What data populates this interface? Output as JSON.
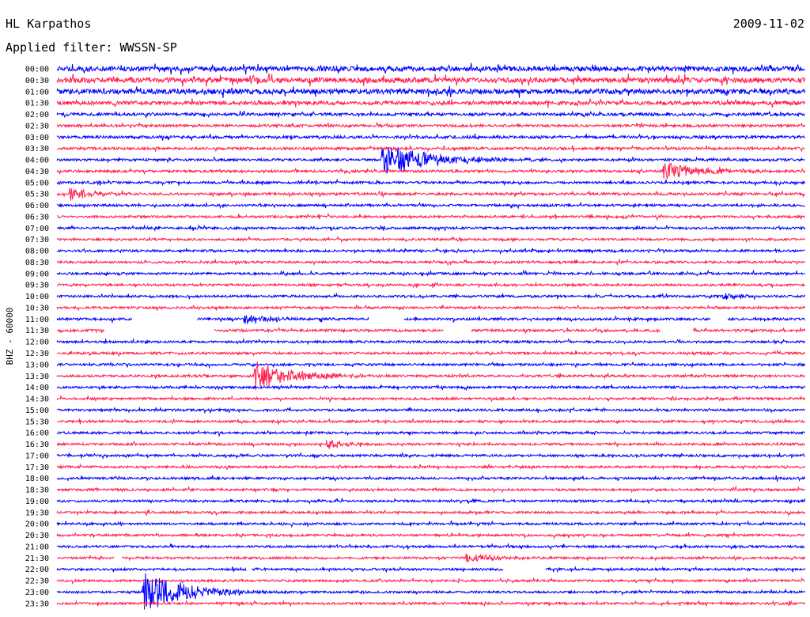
{
  "header": {
    "station": "HL Karpathos",
    "date": "2009-11-02",
    "filter": "Applied filter: WWSSN-SP"
  },
  "chart_data": {
    "type": "line",
    "title": "HL Karpathos",
    "channel_label": "BHZ - 60000",
    "time_labels": [
      "00:00",
      "00:30",
      "01:00",
      "01:30",
      "02:00",
      "02:30",
      "03:00",
      "03:30",
      "04:00",
      "04:30",
      "05:00",
      "05:30",
      "06:00",
      "06:30",
      "07:00",
      "07:30",
      "08:00",
      "08:30",
      "09:00",
      "09:30",
      "10:00",
      "10:30",
      "11:00",
      "11:30",
      "12:00",
      "12:30",
      "13:00",
      "13:30",
      "14:00",
      "14:30",
      "15:00",
      "15:30",
      "16:00",
      "16:30",
      "17:00",
      "17:30",
      "18:00",
      "18:30",
      "19:00",
      "19:30",
      "20:00",
      "20:30",
      "21:00",
      "21:30",
      "22:00",
      "22:30",
      "23:00",
      "23:30"
    ],
    "trace_colors": [
      "#0000ff",
      "#ff2050"
    ],
    "minutes_per_line": 30,
    "noise_level_by_line": [
      3.0,
      3.2,
      3.2,
      2.4,
      1.8,
      1.6,
      1.7,
      1.6,
      1.5,
      1.5,
      1.5,
      1.5,
      1.4,
      1.4,
      1.4,
      1.4,
      1.4,
      1.4,
      1.4,
      1.4,
      1.4,
      1.4,
      1.5,
      1.5,
      1.4,
      1.4,
      1.4,
      1.4,
      1.4,
      1.4,
      1.4,
      1.4,
      1.4,
      1.4,
      1.4,
      1.4,
      1.4,
      1.4,
      1.4,
      1.4,
      1.4,
      1.4,
      1.4,
      1.4,
      1.4,
      1.4,
      1.4,
      1.4
    ],
    "events": [
      {
        "line": 8,
        "minute": 13.0,
        "amplitude": 14,
        "duration_min": 2.0
      },
      {
        "line": 9,
        "minute": 24.3,
        "amplitude": 8,
        "duration_min": 1.4
      },
      {
        "line": 11,
        "minute": 0.5,
        "amplitude": 6,
        "duration_min": 0.8
      },
      {
        "line": 20,
        "minute": 26.7,
        "amplitude": 4,
        "duration_min": 0.6
      },
      {
        "line": 22,
        "minute": 7.5,
        "amplitude": 4,
        "duration_min": 1.0
      },
      {
        "line": 27,
        "minute": 7.9,
        "amplitude": 12,
        "duration_min": 1.6
      },
      {
        "line": 33,
        "minute": 10.8,
        "amplitude": 4,
        "duration_min": 0.8
      },
      {
        "line": 43,
        "minute": 16.4,
        "amplitude": 5,
        "duration_min": 0.9
      },
      {
        "line": 46,
        "minute": 3.4,
        "amplitude": 18,
        "duration_min": 1.6
      }
    ],
    "gaps": [
      {
        "line": 22,
        "start_min": 3.0,
        "end_min": 5.6
      },
      {
        "line": 22,
        "start_min": 12.5,
        "end_min": 13.9
      },
      {
        "line": 22,
        "start_min": 26.2,
        "end_min": 26.9
      },
      {
        "line": 23,
        "start_min": 1.9,
        "end_min": 6.3
      },
      {
        "line": 23,
        "start_min": 15.5,
        "end_min": 16.6
      },
      {
        "line": 23,
        "start_min": 24.2,
        "end_min": 25.5
      },
      {
        "line": 43,
        "start_min": 2.3,
        "end_min": 2.6
      },
      {
        "line": 44,
        "start_min": 7.6,
        "end_min": 7.8
      },
      {
        "line": 44,
        "start_min": 17.9,
        "end_min": 19.6
      }
    ]
  }
}
